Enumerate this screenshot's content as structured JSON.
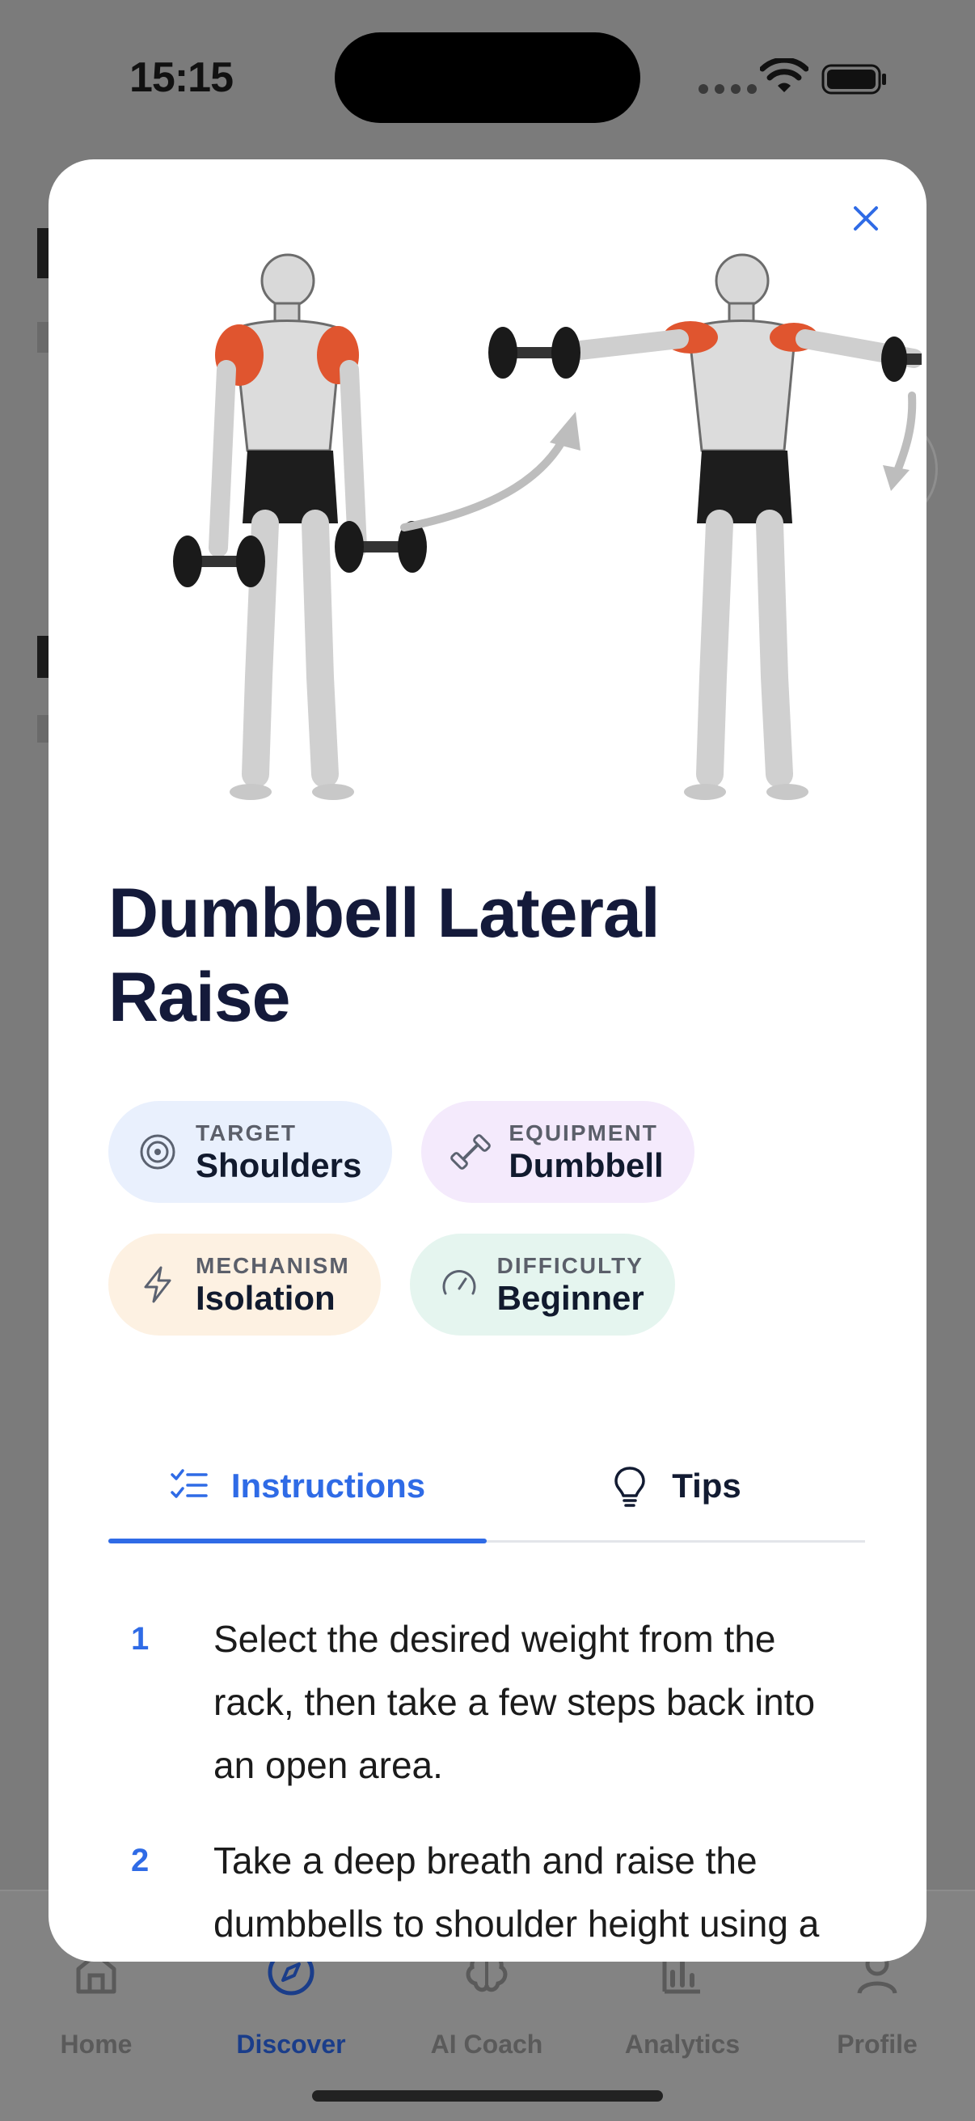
{
  "status_bar": {
    "time": "15:15"
  },
  "tab_bar": {
    "items": [
      {
        "label": "Home",
        "icon": "home-icon",
        "active": false
      },
      {
        "label": "Discover",
        "icon": "compass-icon",
        "active": true
      },
      {
        "label": "AI Coach",
        "icon": "brain-icon",
        "active": false
      },
      {
        "label": "Analytics",
        "icon": "bar-chart-icon",
        "active": false
      },
      {
        "label": "Profile",
        "icon": "person-icon",
        "active": false
      }
    ]
  },
  "exercise": {
    "title": "Dumbbell Lateral Raise",
    "chips": {
      "target": {
        "key": "TARGET",
        "value": "Shoulders",
        "icon": "target-icon"
      },
      "equipment": {
        "key": "EQUIPMENT",
        "value": "Dumbbell",
        "icon": "dumbbell-icon"
      },
      "mechanism": {
        "key": "MECHANISM",
        "value": "Isolation",
        "icon": "lightning-icon"
      },
      "difficulty": {
        "key": "DIFFICULTY",
        "value": "Beginner",
        "icon": "gauge-icon"
      }
    },
    "tabs": {
      "instructions": "Instructions",
      "tips": "Tips"
    },
    "steps": [
      {
        "num": "1",
        "text": "Select the desired weight from the rack, then take a few steps back into an open area."
      },
      {
        "num": "2",
        "text": "Take a deep breath and raise the dumbbells to shoulder height using a"
      }
    ]
  },
  "colors": {
    "accent": "#2f6be6",
    "muscle_highlight": "#e0552f",
    "title": "#141a3a"
  }
}
